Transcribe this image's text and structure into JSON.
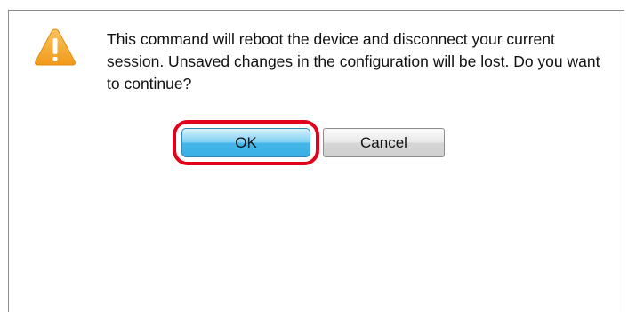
{
  "dialog": {
    "icon": "warning-icon",
    "message": "This command will reboot the device and disconnect your current session. Unsaved changes in the configuration will be lost. Do you want to continue?",
    "ok_label": "OK",
    "cancel_label": "Cancel"
  },
  "colors": {
    "warning_icon": "#f6a623",
    "highlight": "#e3001b",
    "ok_button": "#44b5e8"
  }
}
